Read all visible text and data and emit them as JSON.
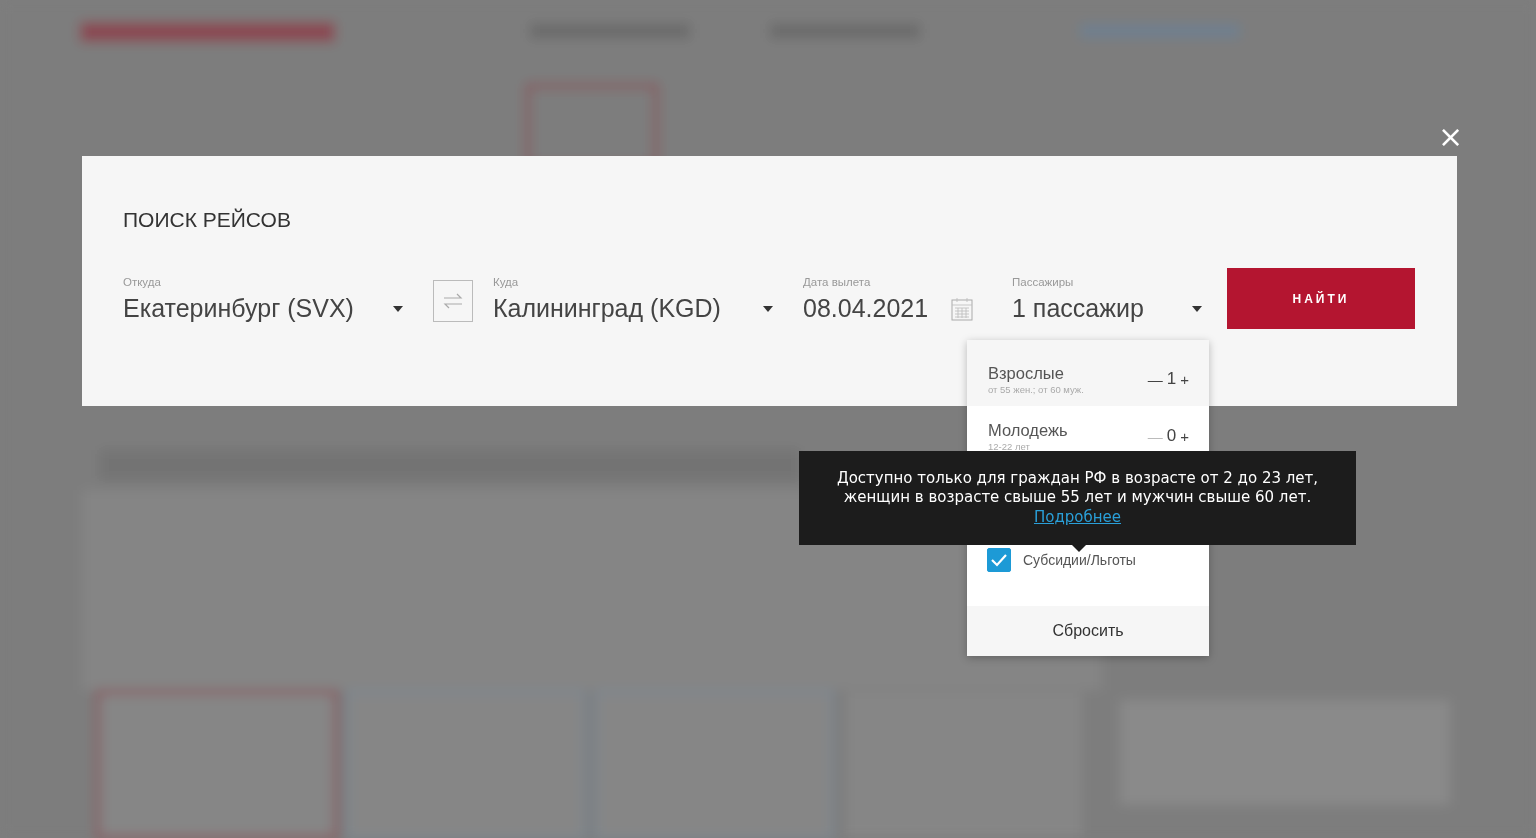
{
  "modal": {
    "title": "ПОИСК РЕЙСОВ",
    "close": "×",
    "from": {
      "label": "Откуда",
      "value": "Екатеринбург (SVX)"
    },
    "to": {
      "label": "Куда",
      "value": "Калининград (KGD)"
    },
    "date": {
      "label": "Дата вылета",
      "value": "08.04.2021"
    },
    "passengers": {
      "label": "Пассажиры",
      "value": "1 пассажир",
      "expanded": true
    },
    "search_button": "НАЙТИ"
  },
  "passenger_menu": {
    "rows": [
      {
        "label": "Взрослые",
        "hint": "от 55 жен.; от 60 муж.",
        "minus": "—",
        "count": "1",
        "plus": "+",
        "minus_disabled": false
      },
      {
        "label": "Молодежь",
        "hint": "12-22 лет",
        "minus": "—",
        "count": "0",
        "plus": "+",
        "minus_disabled": true
      }
    ],
    "checkbox": {
      "label": "Субсидии/Льготы",
      "checked": true
    },
    "reset": "Сбросить"
  },
  "tooltip": {
    "lines": [
      "Доступно только для граждан РФ в возрасте от 2 до 23 лет,",
      "женщин в возрасте свыше 55 лет и мужчин свыше 60 лет."
    ],
    "link": "Подробнее"
  }
}
